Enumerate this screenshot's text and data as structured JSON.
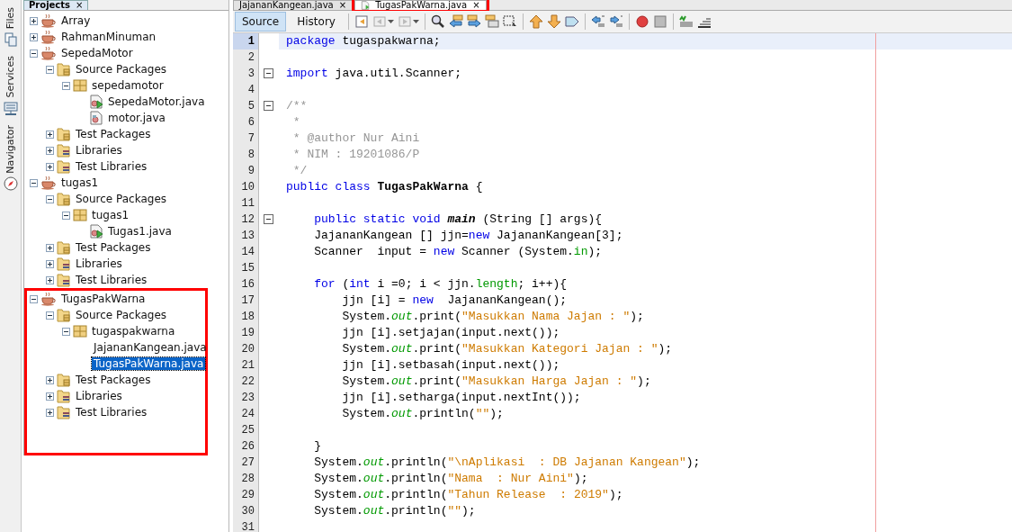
{
  "side_tabs": [
    {
      "label": "Files"
    },
    {
      "label": "Services"
    },
    {
      "label": "Navigator"
    }
  ],
  "projects_panel": {
    "title": "Projects",
    "close": "×",
    "tree": [
      {
        "label": "Array",
        "kind": "project",
        "expanded": false,
        "selected": false,
        "highlighted": false
      },
      {
        "label": "RahmanMinuman",
        "kind": "project",
        "expanded": false,
        "selected": false,
        "highlighted": false
      },
      {
        "label": "SepedaMotor",
        "kind": "project",
        "expanded": true,
        "selected": false,
        "highlighted": false,
        "children": [
          {
            "label": "Source Packages",
            "kind": "src",
            "expanded": true,
            "selected": false,
            "children": [
              {
                "label": "sepedamotor",
                "kind": "package",
                "expanded": true,
                "selected": false,
                "children": [
                  {
                    "label": "SepedaMotor.java",
                    "kind": "main",
                    "selected": false
                  },
                  {
                    "label": "motor.java",
                    "kind": "java",
                    "selected": false
                  }
                ]
              }
            ]
          },
          {
            "label": "Test Packages",
            "kind": "src",
            "expanded": false,
            "selected": false
          },
          {
            "label": "Libraries",
            "kind": "lib",
            "expanded": false,
            "selected": false
          },
          {
            "label": "Test Libraries",
            "kind": "lib",
            "expanded": false,
            "selected": false
          }
        ]
      },
      {
        "label": "tugas1",
        "kind": "project",
        "expanded": true,
        "selected": false,
        "highlighted": false,
        "children": [
          {
            "label": "Source Packages",
            "kind": "src",
            "expanded": true,
            "selected": false,
            "children": [
              {
                "label": "tugas1",
                "kind": "package",
                "expanded": true,
                "selected": false,
                "children": [
                  {
                    "label": "Tugas1.java",
                    "kind": "main",
                    "selected": false
                  }
                ]
              }
            ]
          },
          {
            "label": "Test Packages",
            "kind": "src",
            "expanded": false,
            "selected": false
          },
          {
            "label": "Libraries",
            "kind": "lib",
            "expanded": false,
            "selected": false
          },
          {
            "label": "Test Libraries",
            "kind": "lib",
            "expanded": false,
            "selected": false
          }
        ]
      },
      {
        "label": "TugasPakWarna",
        "kind": "project",
        "expanded": true,
        "selected": false,
        "highlighted": true,
        "children": [
          {
            "label": "Source Packages",
            "kind": "src",
            "expanded": true,
            "selected": false,
            "children": [
              {
                "label": "tugaspakwarna",
                "kind": "package",
                "expanded": true,
                "selected": false,
                "children": [
                  {
                    "label": "JajananKangean.java",
                    "kind": "java",
                    "selected": false
                  },
                  {
                    "label": "TugasPakWarna.java",
                    "kind": "main",
                    "selected": true
                  }
                ]
              }
            ]
          },
          {
            "label": "Test Packages",
            "kind": "src",
            "expanded": false,
            "selected": false
          },
          {
            "label": "Libraries",
            "kind": "lib",
            "expanded": false,
            "selected": false
          },
          {
            "label": "Test Libraries",
            "kind": "lib",
            "expanded": false,
            "selected": false
          }
        ]
      }
    ]
  },
  "editor_tabs": [
    {
      "label": "JajananKangean.java",
      "close": "×",
      "selected": false,
      "highlighted": false
    },
    {
      "label": "TugasPakWarna.java",
      "close": "×",
      "selected": true,
      "highlighted": true
    }
  ],
  "view_buttons": [
    {
      "label": "Source",
      "selected": true
    },
    {
      "label": "History",
      "selected": false
    }
  ],
  "code_lines": [
    {
      "number": "1",
      "foldable": false,
      "current": true,
      "tokens": [
        {
          "kind": "kw",
          "text": "package"
        },
        {
          "kind": "plain",
          "text": " tugaspakwarna;"
        }
      ]
    },
    {
      "number": "2",
      "foldable": false,
      "current": false
    },
    {
      "number": "3",
      "foldable": true,
      "current": false,
      "tokens": [
        {
          "kind": "kw",
          "text": "import"
        },
        {
          "kind": "plain",
          "text": " java.util.Scanner;"
        }
      ]
    },
    {
      "number": "4",
      "foldable": false,
      "current": false
    },
    {
      "number": "5",
      "foldable": true,
      "current": false,
      "tokens": [
        {
          "kind": "comment",
          "text": "/**"
        }
      ]
    },
    {
      "number": "6",
      "foldable": false,
      "current": false,
      "tokens": [
        {
          "kind": "comment",
          "text": " *"
        }
      ]
    },
    {
      "number": "7",
      "foldable": false,
      "current": false,
      "tokens": [
        {
          "kind": "comment",
          "text": " * @author Nur Aini"
        }
      ]
    },
    {
      "number": "8",
      "foldable": false,
      "current": false,
      "tokens": [
        {
          "kind": "comment",
          "text": " * NIM : 19201086/P"
        }
      ]
    },
    {
      "number": "9",
      "foldable": false,
      "current": false,
      "tokens": [
        {
          "kind": "comment",
          "text": " */"
        }
      ]
    },
    {
      "number": "10",
      "foldable": false,
      "current": false,
      "tokens": [
        {
          "kind": "kw",
          "text": "public class"
        },
        {
          "kind": "type",
          "text": " TugasPakWarna"
        },
        {
          "kind": "plain",
          "text": " {"
        }
      ]
    },
    {
      "number": "11",
      "foldable": false,
      "current": false
    },
    {
      "number": "12",
      "foldable": true,
      "current": false,
      "tokens": [
        {
          "kind": "kw",
          "text": "    public static void"
        },
        {
          "kind": "method",
          "text": " main"
        },
        {
          "kind": "plain",
          "text": " (String [] args){"
        }
      ]
    },
    {
      "number": "13",
      "foldable": false,
      "current": false,
      "tokens": [
        {
          "kind": "plain",
          "text": "    JajananKangean [] jjn="
        },
        {
          "kind": "kw",
          "text": "new"
        },
        {
          "kind": "plain",
          "text": " JajananKangean[3];"
        }
      ]
    },
    {
      "number": "14",
      "foldable": false,
      "current": false,
      "tokens": [
        {
          "kind": "plain",
          "text": "    Scanner  input = "
        },
        {
          "kind": "kw",
          "text": "new"
        },
        {
          "kind": "plain",
          "text": " Scanner (System."
        },
        {
          "kind": "field",
          "text": "in"
        },
        {
          "kind": "plain",
          "text": ");"
        }
      ]
    },
    {
      "number": "15",
      "foldable": false,
      "current": false
    },
    {
      "number": "16",
      "foldable": false,
      "current": false,
      "tokens": [
        {
          "kind": "kw",
          "text": "    for"
        },
        {
          "kind": "plain",
          "text": " ("
        },
        {
          "kind": "kw",
          "text": "int"
        },
        {
          "kind": "plain",
          "text": " i =0; i < jjn."
        },
        {
          "kind": "field",
          "text": "length"
        },
        {
          "kind": "plain",
          "text": "; i++){"
        }
      ]
    },
    {
      "number": "17",
      "foldable": false,
      "current": false,
      "tokens": [
        {
          "kind": "plain",
          "text": "        jjn [i] = "
        },
        {
          "kind": "kw",
          "text": "new"
        },
        {
          "kind": "plain",
          "text": "  JajananKangean();"
        }
      ]
    },
    {
      "number": "18",
      "foldable": false,
      "current": false,
      "tokens": [
        {
          "kind": "plain",
          "text": "        System."
        },
        {
          "kind": "static",
          "text": "out"
        },
        {
          "kind": "plain",
          "text": ".print("
        },
        {
          "kind": "str",
          "text": "\"Masukkan Nama Jajan : \""
        },
        {
          "kind": "plain",
          "text": ");"
        }
      ]
    },
    {
      "number": "19",
      "foldable": false,
      "current": false,
      "tokens": [
        {
          "kind": "plain",
          "text": "        jjn [i].setjajan(input.next());"
        }
      ]
    },
    {
      "number": "20",
      "foldable": false,
      "current": false,
      "tokens": [
        {
          "kind": "plain",
          "text": "        System."
        },
        {
          "kind": "static",
          "text": "out"
        },
        {
          "kind": "plain",
          "text": ".print("
        },
        {
          "kind": "str",
          "text": "\"Masukkan Kategori Jajan : \""
        },
        {
          "kind": "plain",
          "text": ");"
        }
      ]
    },
    {
      "number": "21",
      "foldable": false,
      "current": false,
      "tokens": [
        {
          "kind": "plain",
          "text": "        jjn [i].setbasah(input.next());"
        }
      ]
    },
    {
      "number": "22",
      "foldable": false,
      "current": false,
      "tokens": [
        {
          "kind": "plain",
          "text": "        System."
        },
        {
          "kind": "static",
          "text": "out"
        },
        {
          "kind": "plain",
          "text": ".print("
        },
        {
          "kind": "str",
          "text": "\"Masukkan Harga Jajan : \""
        },
        {
          "kind": "plain",
          "text": ");"
        }
      ]
    },
    {
      "number": "23",
      "foldable": false,
      "current": false,
      "tokens": [
        {
          "kind": "plain",
          "text": "        jjn [i].setharga(input.nextInt());"
        }
      ]
    },
    {
      "number": "24",
      "foldable": false,
      "current": false,
      "tokens": [
        {
          "kind": "plain",
          "text": "        System."
        },
        {
          "kind": "static",
          "text": "out"
        },
        {
          "kind": "plain",
          "text": ".println("
        },
        {
          "kind": "str",
          "text": "\"\""
        },
        {
          "kind": "plain",
          "text": ");"
        }
      ]
    },
    {
      "number": "25",
      "foldable": false,
      "current": false
    },
    {
      "number": "26",
      "foldable": false,
      "current": false,
      "tokens": [
        {
          "kind": "plain",
          "text": "    }"
        }
      ]
    },
    {
      "number": "27",
      "foldable": false,
      "current": false,
      "tokens": [
        {
          "kind": "plain",
          "text": "    System."
        },
        {
          "kind": "static",
          "text": "out"
        },
        {
          "kind": "plain",
          "text": ".println("
        },
        {
          "kind": "str",
          "text": "\"\\nAplikasi  : DB Jajanan Kangean\""
        },
        {
          "kind": "plain",
          "text": ");"
        }
      ]
    },
    {
      "number": "28",
      "foldable": false,
      "current": false,
      "tokens": [
        {
          "kind": "plain",
          "text": "    System."
        },
        {
          "kind": "static",
          "text": "out"
        },
        {
          "kind": "plain",
          "text": ".println("
        },
        {
          "kind": "str",
          "text": "\"Nama  : Nur Aini\""
        },
        {
          "kind": "plain",
          "text": ");"
        }
      ]
    },
    {
      "number": "29",
      "foldable": false,
      "current": false,
      "tokens": [
        {
          "kind": "plain",
          "text": "    System."
        },
        {
          "kind": "static",
          "text": "out"
        },
        {
          "kind": "plain",
          "text": ".println("
        },
        {
          "kind": "str",
          "text": "\"Tahun Release  : 2019\""
        },
        {
          "kind": "plain",
          "text": ");"
        }
      ]
    },
    {
      "number": "30",
      "foldable": false,
      "current": false,
      "tokens": [
        {
          "kind": "plain",
          "text": "    System."
        },
        {
          "kind": "static",
          "text": "out"
        },
        {
          "kind": "plain",
          "text": ".println("
        },
        {
          "kind": "str",
          "text": "\"\""
        },
        {
          "kind": "plain",
          "text": ");"
        }
      ]
    },
    {
      "number": "31",
      "foldable": false,
      "current": false
    }
  ]
}
